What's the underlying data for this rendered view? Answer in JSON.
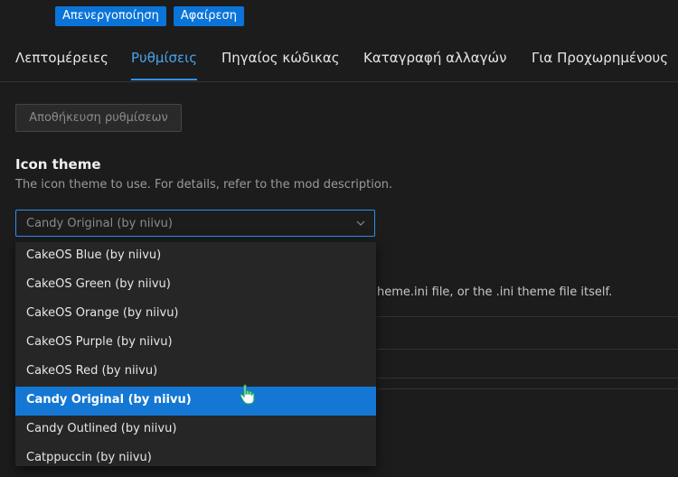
{
  "header": {
    "disable_label": "Απενεργοποίηση",
    "remove_label": "Αφαίρεση"
  },
  "tabs": [
    {
      "label": "Λεπτομέρειες"
    },
    {
      "label": "Ρυθμίσεις",
      "active": true
    },
    {
      "label": "Πηγαίος κώδικας"
    },
    {
      "label": "Καταγραφή αλλαγών"
    },
    {
      "label": "Για Προχωρημένους"
    }
  ],
  "settings": {
    "save_label": "Αποθήκευση ρυθμίσεων",
    "icon_theme": {
      "title": "Icon theme",
      "description": "The icon theme to use. For details, refer to the mod description.",
      "selected_value": "Candy Original (by niivu)",
      "options": [
        "CakeOS Blue (by niivu)",
        "CakeOS Green (by niivu)",
        "CakeOS Orange (by niivu)",
        "CakeOS Purple (by niivu)",
        "CakeOS Red (by niivu)",
        "Candy Original (by niivu)",
        "Candy Outlined (by niivu)",
        "Catppuccin (by niivu)"
      ]
    },
    "obscured_text": "heme.ini file, or the .ini theme file itself."
  },
  "colors": {
    "accent": "#0a74d9",
    "selection": "#1477d4",
    "background": "#1c1c1c"
  }
}
